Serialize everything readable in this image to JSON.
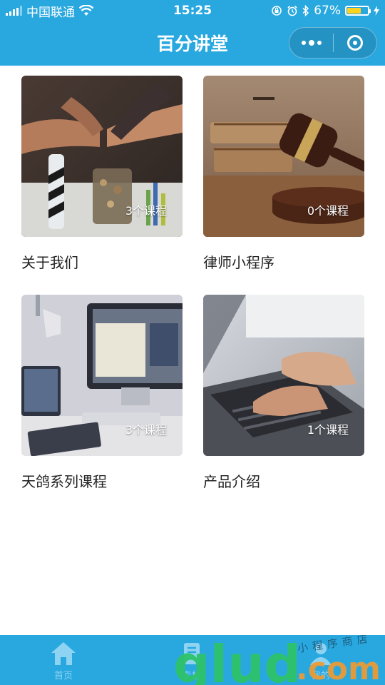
{
  "status_bar": {
    "carrier": "中国联通",
    "time": "15:25",
    "battery": "67%",
    "battery_level": 0.67
  },
  "header": {
    "title": "百分讲堂"
  },
  "cards": [
    {
      "title": "关于我们",
      "count": "3个课程",
      "image": "team-fist-bump-photo"
    },
    {
      "title": "律师小程序",
      "count": "0个课程",
      "image": "judge-gavel-photo"
    },
    {
      "title": "天鸽系列课程",
      "count": "3个课程",
      "image": "desk-computer-photo"
    },
    {
      "title": "产品介绍",
      "count": "1个课程",
      "image": "laptop-typing-photo"
    }
  ],
  "tab_bar": {
    "items": [
      {
        "label": "首页",
        "icon": "home-icon"
      },
      {
        "label": "专栏",
        "icon": "column-icon"
      },
      {
        "label": "我的",
        "icon": "user-icon"
      }
    ]
  },
  "watermark": {
    "text_top": "小程序商店",
    "text_main": "glud",
    "text_suffix": ".com",
    "colors": {
      "main": "#2ec36a",
      "suffix": "#f29a2e"
    }
  },
  "colors": {
    "primary": "#29a8e0",
    "tab_inactive": "#8fd3f2"
  }
}
